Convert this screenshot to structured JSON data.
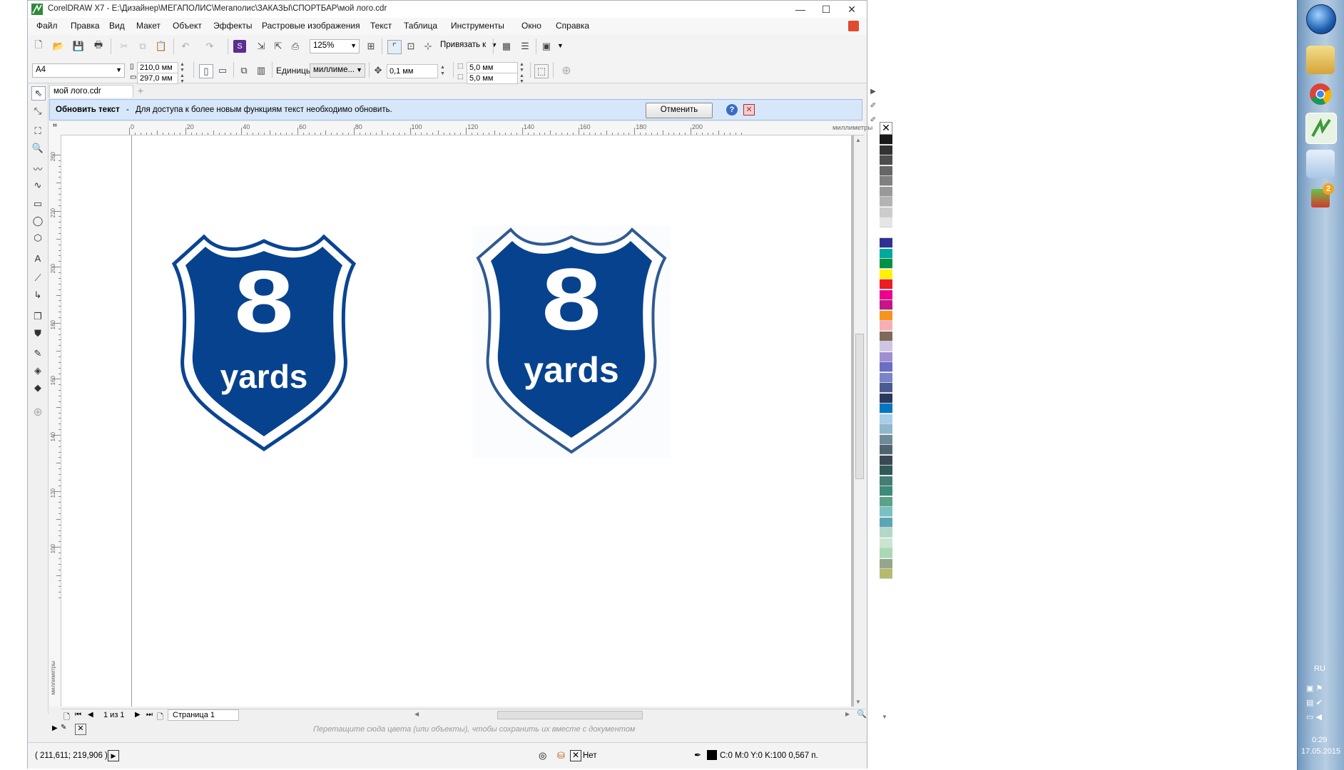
{
  "window": {
    "title": "CorelDRAW X7 - E:\\Дизайнер\\МЕГАПОЛИС\\Мегаполис\\ЗАКАЗЫ\\СПОРТБАР\\мой лого.cdr",
    "minimize": "—",
    "maximize": "☐",
    "close": "✕"
  },
  "menu": [
    "Файл",
    "Правка",
    "Вид",
    "Макет",
    "Объект",
    "Эффекты",
    "Растровые изображения",
    "Текст",
    "Таблица",
    "Инструменты",
    "Окно",
    "Справка"
  ],
  "toolbar": {
    "zoom": "125%",
    "snap_label": "Привязать к"
  },
  "propbar": {
    "page_size": "A4",
    "width": "210,0 мм",
    "height": "297,0 мм",
    "units_label": "Единицы:",
    "units_value": "миллиме...",
    "nudge": "0,1 мм",
    "dup_x": "5,0 мм",
    "dup_y": "5,0 мм"
  },
  "doc_tab": "мой лого.cdr",
  "infobar": {
    "title": "Обновить текст",
    "dash": "-",
    "message": "Для доступа к более новым функциям текст необходимо обновить.",
    "cancel": "Отменить"
  },
  "ruler": {
    "h_ticks": [
      "0",
      "20",
      "40",
      "60",
      "80",
      "100",
      "120",
      "140",
      "160",
      "180",
      "200"
    ],
    "unit": "миллиметры",
    "v_ticks": [
      "260",
      "220",
      "200",
      "180",
      "160",
      "140",
      "120",
      "100"
    ],
    "v_unit": "миллиметры"
  },
  "logos": [
    {
      "digit": "8",
      "word": "yards"
    },
    {
      "digit": "8",
      "word": "yards"
    }
  ],
  "pager": {
    "count": "1 из 1",
    "page_tab": "Страница 1"
  },
  "hint": "Перетащите сюда цвета (или объекты), чтобы сохранить их вместе с документом",
  "status": {
    "coords": "( 211,611; 219,906 )",
    "fill_none": "Нет",
    "outline": "C:0 M:0 Y:0 K:100  0,567 п."
  },
  "palette_colors": [
    "#1a1a1a",
    "#333333",
    "#4d4d4d",
    "#666666",
    "#808080",
    "#999999",
    "#b3b3b3",
    "#cccccc",
    "#e6e6e6",
    "#ffffff",
    "#2e3192",
    "#00a99d",
    "#009245",
    "#fff200",
    "#ed1c24",
    "#ec008c",
    "#c4168b",
    "#f7941d",
    "#f9aeb5",
    "#7f6a59",
    "#d1c3e6",
    "#9e8fd0",
    "#6d6cc6",
    "#7a85c9",
    "#4a5c8f",
    "#2a3a5e",
    "#0077c0",
    "#a6cfe9",
    "#8fb8cc",
    "#6e8b9a",
    "#4e6570",
    "#3a4a54",
    "#2f5a55",
    "#457c75",
    "#3d8c7a",
    "#5aa38a",
    "#79c0c3",
    "#5aa6b5",
    "#b3d8c9",
    "#c8e6cf",
    "#a8d9b2",
    "#95a68c",
    "#b5bb6c"
  ],
  "taskbar": {
    "lang": "RU",
    "time": "0:29",
    "date": "17.05.2015"
  },
  "colors": {
    "shield_blue": "#07428f",
    "shield_outline": "#2f5a92"
  }
}
